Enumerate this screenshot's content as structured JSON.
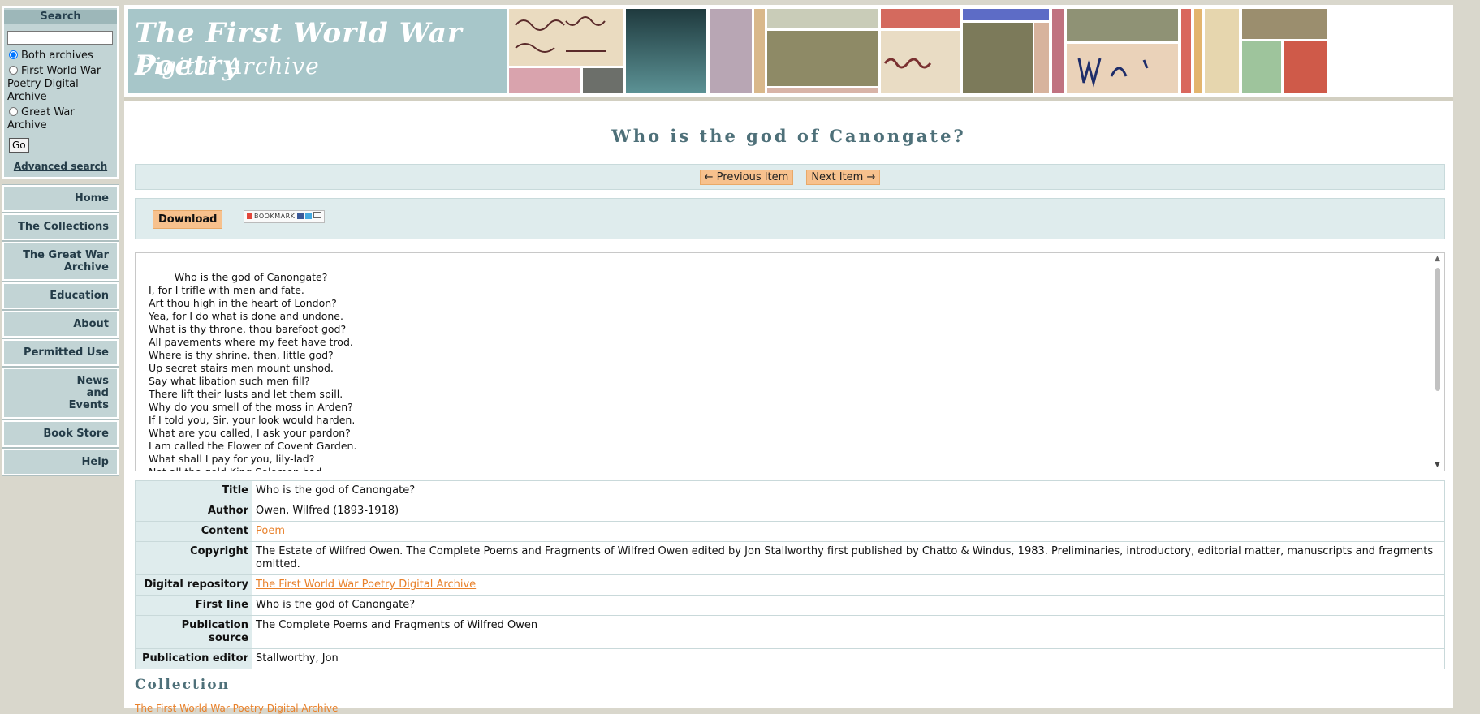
{
  "search": {
    "heading": "Search",
    "input_value": "",
    "options": [
      "Both archives",
      "First World War Poetry Digital Archive",
      "Great War Archive"
    ],
    "selected": 0,
    "go_label": "Go",
    "advanced_label": "Advanced search"
  },
  "nav": {
    "items": [
      {
        "label": "Home"
      },
      {
        "label": "The Collections"
      },
      {
        "label": "The Great War Archive"
      },
      {
        "label": "Education"
      },
      {
        "label": "About"
      },
      {
        "label": "Permitted Use"
      },
      {
        "label": "News and Events"
      },
      {
        "label": "Book Store"
      },
      {
        "label": "Help"
      }
    ]
  },
  "banner": {
    "logo_line1": "The First World War Poetry",
    "logo_line2": "Digital Archive"
  },
  "page": {
    "title": "Who is the god of Canongate?",
    "prev_label": "← Previous Item",
    "next_label": "Next Item →",
    "download_label": "Download",
    "bookmark_label": "BOOKMARK"
  },
  "poem": {
    "lines": [
      "        Who is the god of Canongate?",
      "I, for I trifle with men and fate.",
      "Art thou high in the heart of London?",
      "Yea, for I do what is done and undone.",
      "What is thy throne, thou barefoot god?",
      "All pavements where my feet have trod.",
      "Where is thy shrine, then, little god?",
      "Up secret stairs men mount unshod.",
      "Say what libation such men fill?",
      "There lift their lusts and let them spill.",
      "Why do you smell of the moss in Arden?",
      "If I told you, Sir, your look would harden.",
      "What are you called, I ask your pardon?",
      "I am called the Flower of Covent Garden.",
      "What shall I pay for you, lily-lad?",
      "Not all the gold King Solomon had."
    ]
  },
  "metadata": {
    "title_label": "Title",
    "title_value": "Who is the god of Canongate?",
    "author_label": "Author",
    "author_value": "Owen, Wilfred (1893-1918)",
    "content_label": "Content",
    "content_value": "Poem",
    "copyright_label": "Copyright",
    "copyright_value": "The Estate of Wilfred Owen. The Complete Poems and Fragments of Wilfred Owen edited by Jon Stallworthy first published by Chatto & Windus, 1983. Preliminaries, introductory, editorial matter, manuscripts and fragments omitted.",
    "repository_label": "Digital repository",
    "repository_value": "The First World War Poetry Digital Archive",
    "firstline_label": "First line",
    "firstline_value": "Who is the god of Canongate?",
    "pubsource_label": "Publication source",
    "pubsource_value": "The Complete Poems and Fragments of Wilfred Owen",
    "pubeditor_label": "Publication editor",
    "pubeditor_value": "Stallworthy, Jon"
  },
  "collection": {
    "heading": "Collection",
    "link": "The First World War Poetry Digital Archive"
  },
  "colors": {
    "accent_orange": "#f7c18d",
    "link_orange": "#e8812b",
    "teal_panel": "#c2d4d5",
    "heading_teal": "#4e7079"
  }
}
